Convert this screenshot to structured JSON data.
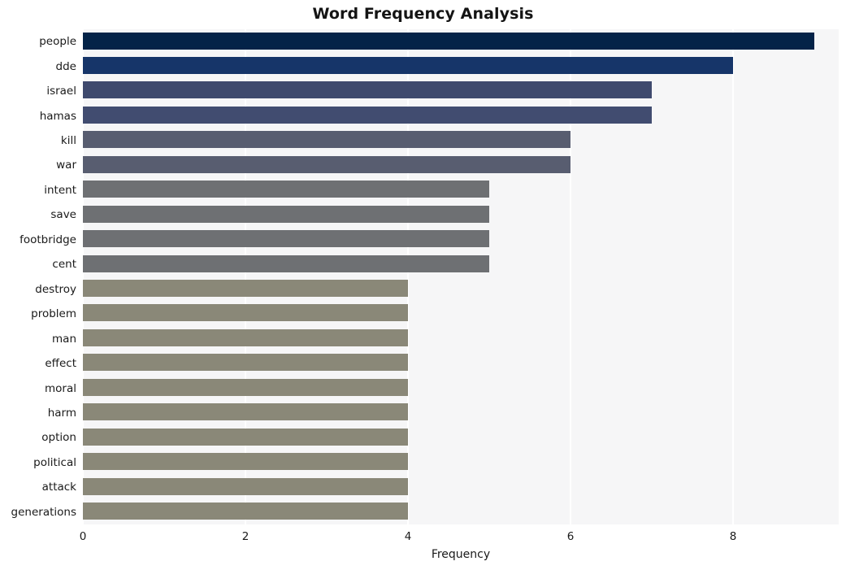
{
  "chart_data": {
    "type": "bar",
    "orientation": "horizontal",
    "title": "Word Frequency Analysis",
    "xlabel": "Frequency",
    "ylabel": "",
    "categories": [
      "people",
      "dde",
      "israel",
      "hamas",
      "kill",
      "war",
      "intent",
      "save",
      "footbridge",
      "cent",
      "destroy",
      "problem",
      "man",
      "effect",
      "moral",
      "harm",
      "option",
      "political",
      "attack",
      "generations"
    ],
    "values": [
      9,
      8,
      7,
      7,
      6,
      6,
      5,
      5,
      5,
      5,
      4,
      4,
      4,
      4,
      4,
      4,
      4,
      4,
      4,
      4
    ],
    "xlim": [
      0,
      9.3
    ],
    "xticks": [
      0,
      2,
      4,
      6,
      8
    ],
    "xtick_labels": [
      "0",
      "2",
      "4",
      "6",
      "8"
    ],
    "grid": true,
    "grid_axis": "x",
    "grid_color": "#ffffff",
    "legend": null,
    "plot_background": "#f6f6f7",
    "figure_background": "#ffffff",
    "bar_colors": [
      "#042348",
      "#163569",
      "#3f4a6e",
      "#414c70",
      "#585d70",
      "#585d70",
      "#6e7073",
      "#6e7073",
      "#6e7073",
      "#6e7073",
      "#8a8878",
      "#8a8878",
      "#8a8878",
      "#8a8878",
      "#8a8878",
      "#8a8878",
      "#8a8878",
      "#8a8878",
      "#8a8878",
      "#8a8878"
    ]
  }
}
